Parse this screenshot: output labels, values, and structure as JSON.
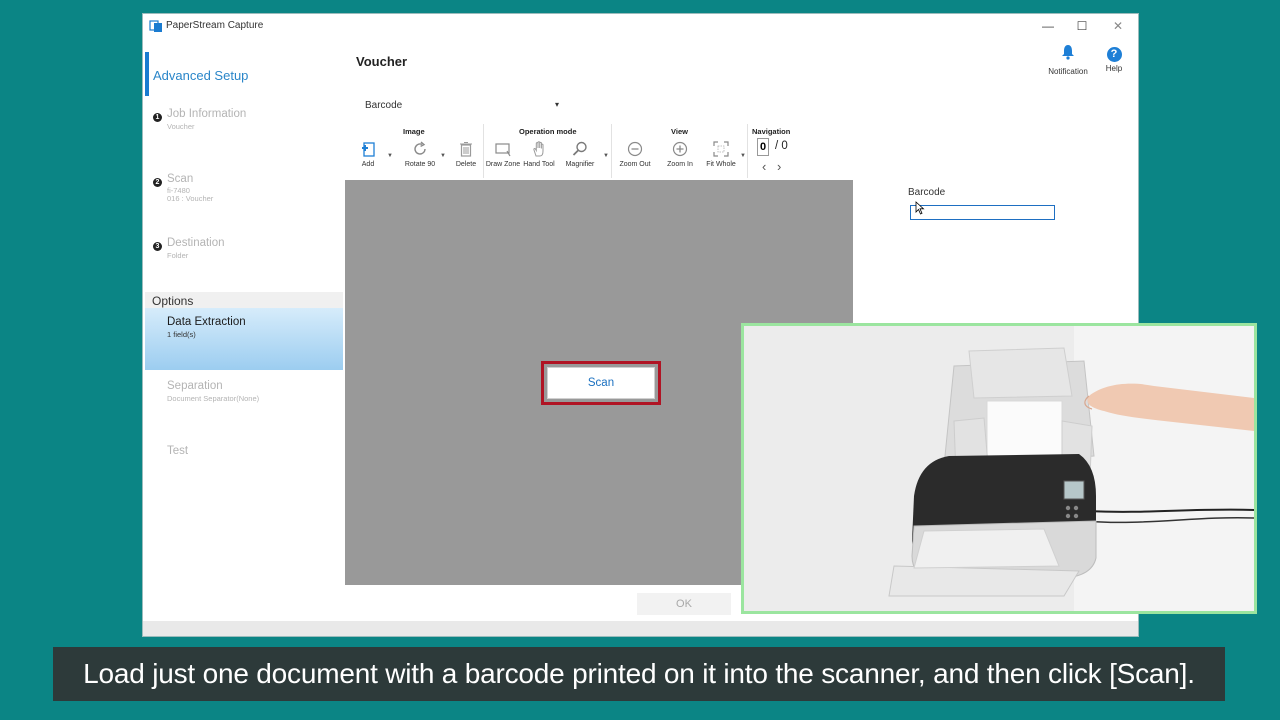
{
  "window": {
    "title": "PaperStream Capture",
    "minimize": "—",
    "maximize": "☐",
    "close": "✕"
  },
  "sidebar": {
    "title": "Advanced Setup",
    "steps": [
      {
        "num": "1",
        "title": "Job Information",
        "sub": [
          "Voucher"
        ]
      },
      {
        "num": "2",
        "title": "Scan",
        "sub": [
          "fi-7480",
          "016 : Voucher"
        ]
      },
      {
        "num": "3",
        "title": "Destination",
        "sub": [
          "Folder"
        ]
      }
    ],
    "options_header": "Options",
    "options": [
      {
        "title": "Data Extraction",
        "sub": "1 field(s)",
        "selected": true
      },
      {
        "title": "Separation",
        "sub": "Document Separator(None)"
      },
      {
        "title": "Test",
        "sub": ""
      }
    ]
  },
  "header": {
    "title": "Voucher",
    "notification": "Notification",
    "help": "Help",
    "help_glyph": "?"
  },
  "barcode_select": {
    "value": "Barcode",
    "arrow": "▾"
  },
  "toolbar": {
    "groups": {
      "image": "Image",
      "operation": "Operation mode",
      "view": "View",
      "navigation": "Navigation"
    },
    "buttons": {
      "add": "Add",
      "rotate": "Rotate 90",
      "delete": "Delete",
      "draw_zone": "Draw Zone",
      "hand_tool": "Hand Tool",
      "magnifier": "Magnifier",
      "zoom_out": "Zoom Out",
      "zoom_in": "Zoom In",
      "fit_whole": "Fit Whole"
    },
    "dropdown_arrow": "▼",
    "navigation": {
      "current": "0",
      "total": "/ 0",
      "prev": "‹",
      "next": "›"
    }
  },
  "canvas": {
    "scan_label": "Scan"
  },
  "field_panel": {
    "label": "Barcode",
    "value": ""
  },
  "ok_label": "OK",
  "subtitle": "Load just one document with a barcode printed on it into the scanner, and then click [Scan].",
  "colors": {
    "background": "#0b8585",
    "accent": "#1a7bd0",
    "scan_highlight": "#b01424",
    "video_border": "#9be59f"
  }
}
